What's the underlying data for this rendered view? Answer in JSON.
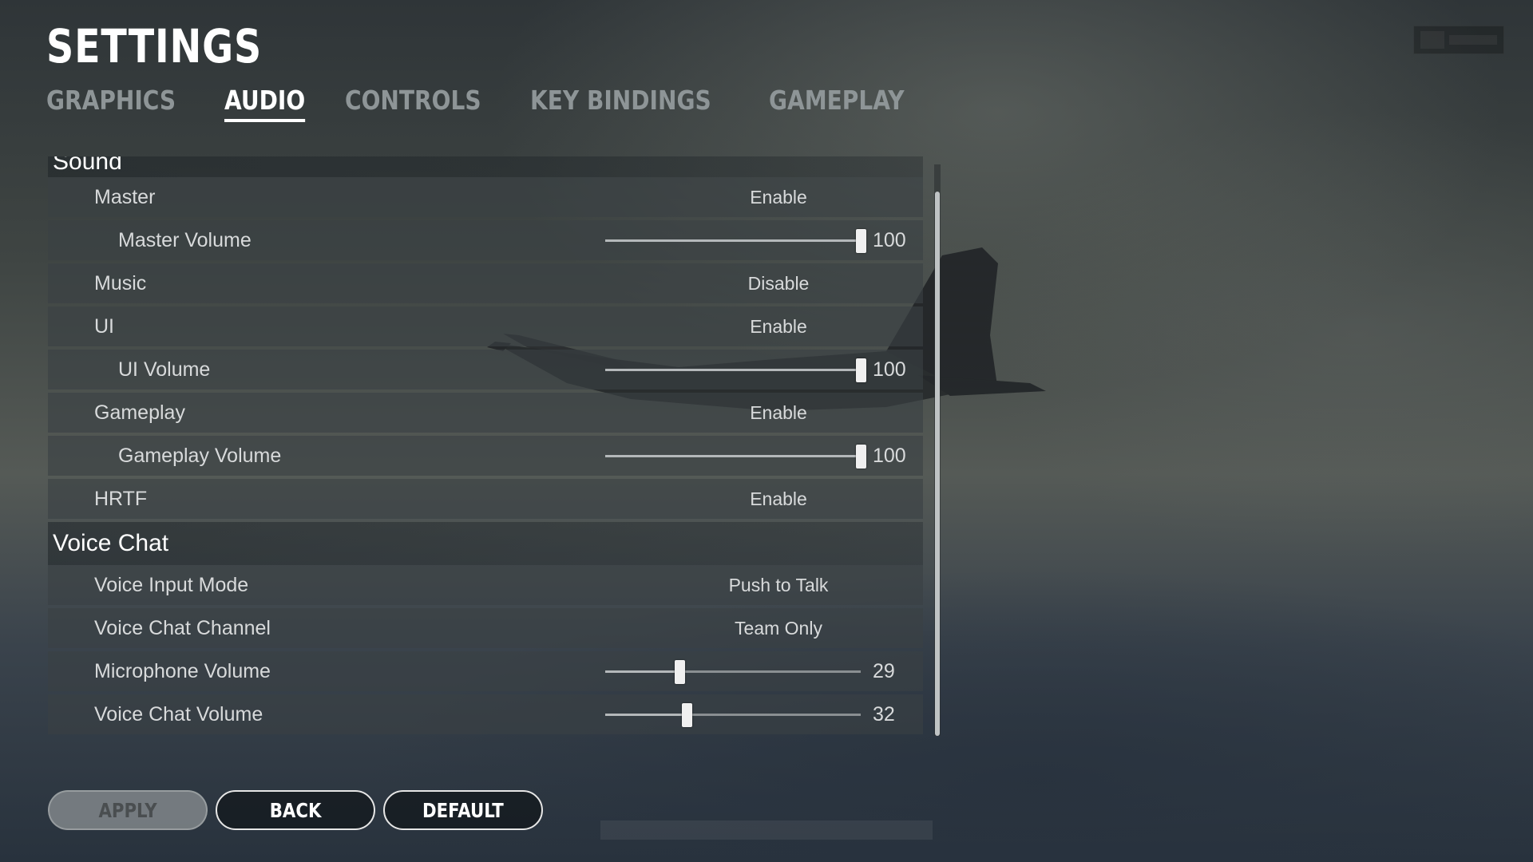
{
  "header": {
    "title": "SETTINGS"
  },
  "tabs": [
    {
      "label": "GRAPHICS",
      "active": false
    },
    {
      "label": "AUDIO",
      "active": true
    },
    {
      "label": "CONTROLS",
      "active": false
    },
    {
      "label": "KEY BINDINGS",
      "active": false
    },
    {
      "label": "GAMEPLAY",
      "active": false
    }
  ],
  "sound": {
    "section_label": "Sound",
    "master": {
      "label": "Master",
      "value": "Enable"
    },
    "master_volume": {
      "label": "Master Volume",
      "value": "100",
      "level": 100
    },
    "music": {
      "label": "Music",
      "value": "Disable"
    },
    "ui": {
      "label": "UI",
      "value": "Enable"
    },
    "ui_volume": {
      "label": "UI Volume",
      "value": "100",
      "level": 100
    },
    "gameplay": {
      "label": "Gameplay",
      "value": "Enable"
    },
    "gameplay_volume": {
      "label": "Gameplay Volume",
      "value": "100",
      "level": 100
    },
    "hrtf": {
      "label": "HRTF",
      "value": "Enable"
    }
  },
  "voice_chat": {
    "section_label": "Voice Chat",
    "input_mode": {
      "label": "Voice Input Mode",
      "value": "Push to Talk"
    },
    "channel": {
      "label": "Voice Chat Channel",
      "value": "Team Only"
    },
    "mic_volume": {
      "label": "Microphone Volume",
      "value": "29",
      "level": 29
    },
    "chat_volume": {
      "label": "Voice Chat Volume",
      "value": "32",
      "level": 32
    }
  },
  "buttons": {
    "apply": "APPLY",
    "back": "BACK",
    "default": "DEFAULT"
  },
  "colors": {
    "accent": "#ffffff",
    "tab_inactive": "#8e9597",
    "row_bg": "#3a4044",
    "apply_disabled": "#8c9294"
  }
}
